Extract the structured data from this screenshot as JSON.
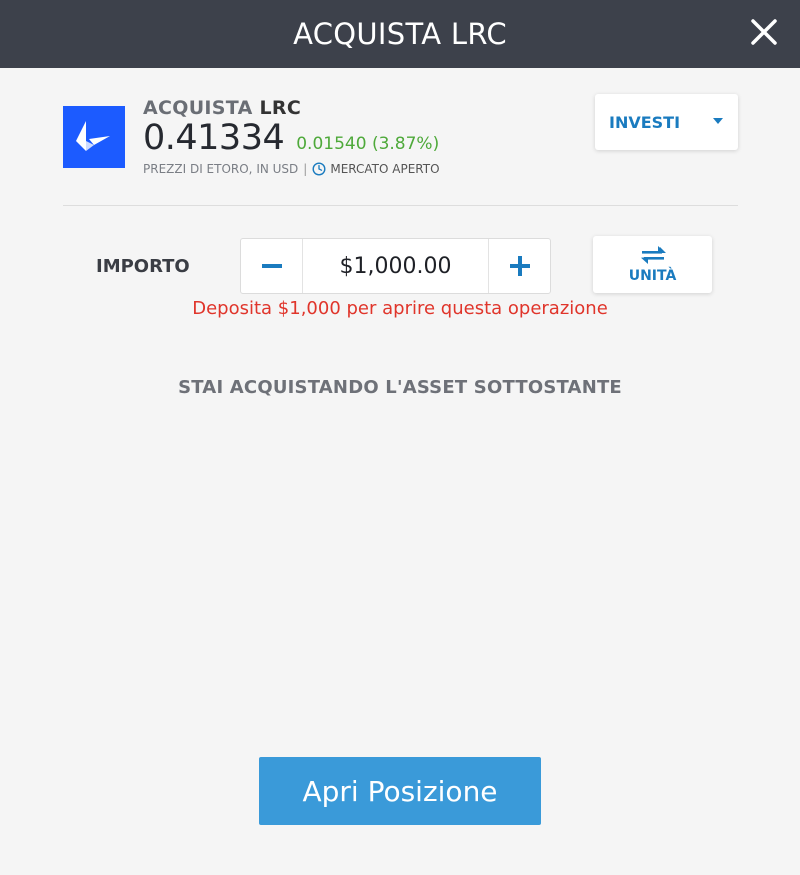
{
  "header": {
    "title": "ACQUISTA LRC",
    "close_icon": "close-icon"
  },
  "asset": {
    "action": "ACQUISTA",
    "symbol": "LRC",
    "price": "0.41334",
    "change": "0.01540 (3.87%)",
    "source_note": "PREZZI DI ETORO, IN USD",
    "separator": "|",
    "market_status": "MERCATO APERTO",
    "logo_color": "#1c5bff",
    "change_color": "#4ea93a"
  },
  "order_type": {
    "selected": "INVESTI"
  },
  "amount": {
    "label": "IMPORTO",
    "value": "$1,000.00",
    "minus_icon": "minus-icon",
    "plus_icon": "plus-icon",
    "units_label": "UNITÀ",
    "error": "Deposita $1,000 per aprire questa operazione"
  },
  "info": {
    "text": "STAI ACQUISTANDO L'ASSET SOTTOSTANTE"
  },
  "footer": {
    "open_button": "Apri Posizione",
    "accent": "#3a9ad9"
  }
}
